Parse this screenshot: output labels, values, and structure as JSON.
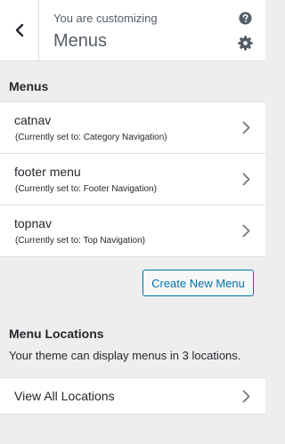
{
  "header": {
    "subtitle": "You are customizing",
    "title": "Menus"
  },
  "menus_section": {
    "heading": "Menus",
    "items": [
      {
        "name": "catnav",
        "assignment": "(Currently set to: Category Navigation)"
      },
      {
        "name": "footer menu",
        "assignment": "(Currently set to: Footer Navigation)"
      },
      {
        "name": "topnav",
        "assignment": "(Currently set to: Top Navigation)"
      }
    ],
    "create_button_label": "Create New Menu"
  },
  "locations_section": {
    "heading": "Menu Locations",
    "description": "Your theme can display menus in 3 locations.",
    "view_all_label": "View All Locations"
  },
  "icons": {
    "back": "chevron-left-icon",
    "help": "help-icon",
    "settings": "gear-icon",
    "item_arrow": "chevron-right-icon"
  },
  "colors": {
    "accent": "#0073aa",
    "panel_bg": "#eeeeee",
    "text": "#23282d",
    "muted_text": "#555d66"
  }
}
